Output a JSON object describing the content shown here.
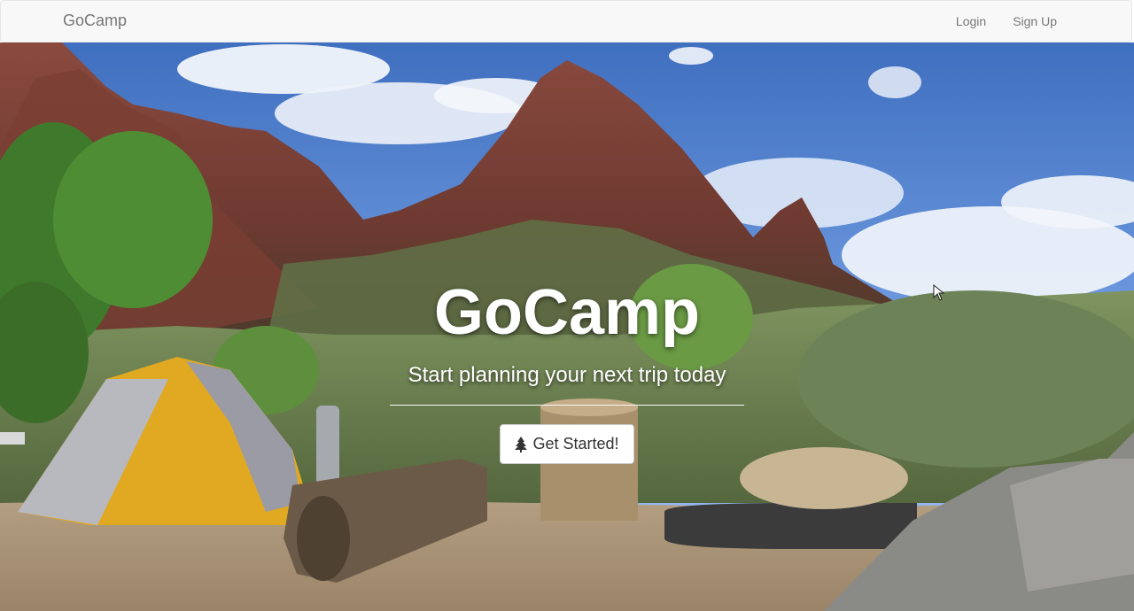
{
  "navbar": {
    "brand": "GoCamp",
    "links": [
      {
        "label": "Login"
      },
      {
        "label": "Sign Up"
      }
    ]
  },
  "hero": {
    "title": "GoCamp",
    "subtitle": "Start planning your next trip today",
    "cta_label": "Get Started!",
    "cta_icon": "tree-icon",
    "background_description_icon": "campsite-photo"
  },
  "colors": {
    "navbar_bg": "#f8f8f8",
    "navbar_text": "#777777",
    "hero_text": "#ffffff",
    "button_bg": "#ffffff",
    "button_text": "#333333"
  }
}
